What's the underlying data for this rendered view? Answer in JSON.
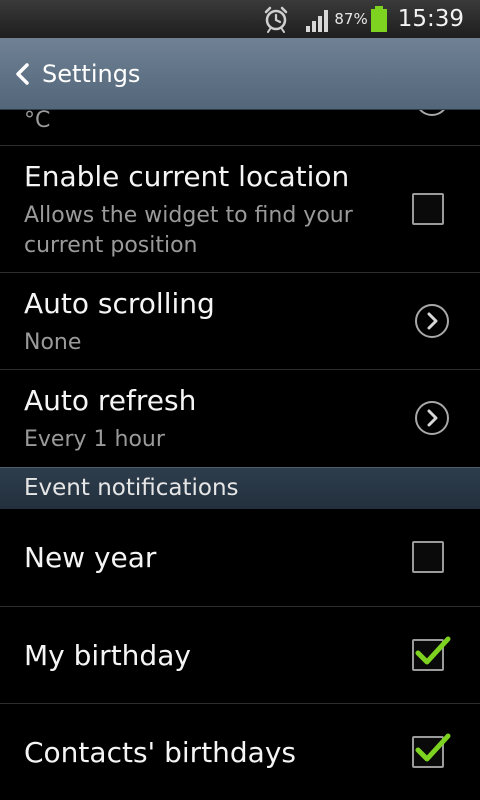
{
  "status_bar": {
    "battery_percent": "87%",
    "time": "15:39",
    "icons": [
      "alarm-icon",
      "signal-icon",
      "battery-icon"
    ]
  },
  "action_bar": {
    "title": "Settings",
    "back_icon": "back-chevron-icon"
  },
  "list": {
    "partial_row_value": "°C",
    "location": {
      "title": "Enable current location",
      "subtitle_line1": "Allows the widget to find your",
      "subtitle_line2": "current position",
      "checked": false
    },
    "auto_scrolling": {
      "title": "Auto scrolling",
      "value": "None"
    },
    "auto_refresh": {
      "title": "Auto refresh",
      "value": "Every 1 hour"
    },
    "section_event_notifications": "Event notifications",
    "new_year": {
      "title": "New year",
      "checked": false
    },
    "my_birthday": {
      "title": "My birthday",
      "checked": true
    },
    "contacts_birthdays": {
      "title": "Contacts' birthdays",
      "checked": true
    }
  },
  "colors": {
    "action_bar": "#5e7185",
    "section_header": "#283645",
    "check_green": "#7ed321",
    "subtitle_gray": "#9a9a9a"
  }
}
